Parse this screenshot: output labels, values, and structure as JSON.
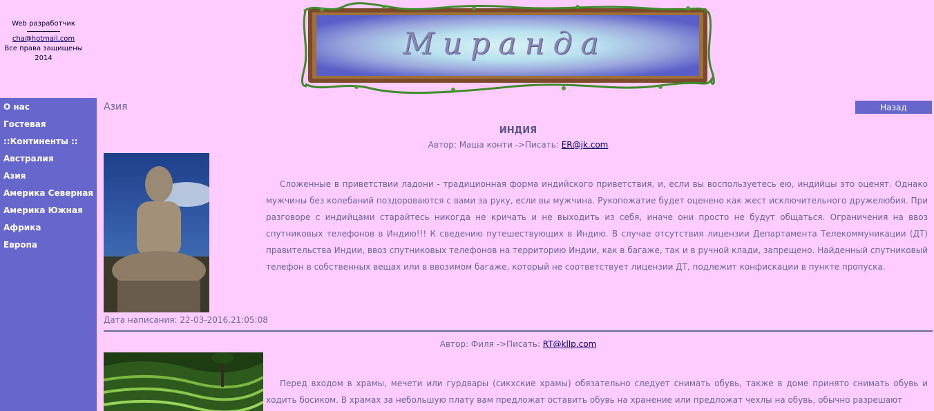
{
  "header": {
    "developer": "Web разработчик",
    "email": "cha@hotmail.com",
    "rights": "Все права защищены",
    "year": "2014",
    "site_title": "Миранда"
  },
  "sidebar": {
    "items": [
      {
        "label": "О нас"
      },
      {
        "label": "Гостевая"
      },
      {
        "label": "::Континенты ::"
      },
      {
        "label": "Австралия"
      },
      {
        "label": "Азия"
      },
      {
        "label": "Америка Северная"
      },
      {
        "label": "Америка Южная"
      },
      {
        "label": "Африка"
      },
      {
        "label": "Европа"
      }
    ]
  },
  "main": {
    "section_title": "Азия",
    "back_label": "Назад",
    "articles": [
      {
        "title": "ИНДИЯ",
        "author_prefix": "Автор:  Маша конти ->Писать: ",
        "author_email": "ER@jk.com",
        "text": "Сложенные в приветствии ладони - традиционная форма индийского приветствия, и, если вы воспользуетесь ею, индийцы это оценят. Однако мужчины без колебаний поздороваются с вами за руку, если вы мужчина. Рукопожатие будет оценено как жест исключительного дружелюбия. При разговоре с индийцами старайтесь никогда не кричать и не выходить из себя, иначе они просто не будут общаться. Ограничения на ввоз спутниковых телефонов в Индию!!! К сведению путешествующих в Индию. В случае отсутствия лицензии Департамента Телекоммуникации (ДТ) правительства Индии, ввоз спутниковых телефонов на территорию Индии, как в багаже, так и в ручной клади, запрещено. Найденный спутниковый телефон в собственных вещах или в ввозимом багаже, который не соответствует лицензии ДТ, подлежит конфискации в пункте пропуска.",
        "date": "Дата написания: 22-03-2016,21:05:08"
      },
      {
        "author_prefix": "Автор:  Филя ->Писать: ",
        "author_email": "RT@kllp.com",
        "text": "Перед входом в храмы, мечети или гурдвары (сикхские храмы) обязательно следует снимать обувь, также в доме принято снимать обувь и ходить босиком. В храмах за небольшую плату вам предложат оставить обувь на хранение или предложат чехлы на обувь, обычно разрешают"
      }
    ]
  },
  "colors": {
    "background": "#ffccff",
    "sidebar": "#6666cc",
    "text": "#666699",
    "link": "#000066"
  }
}
